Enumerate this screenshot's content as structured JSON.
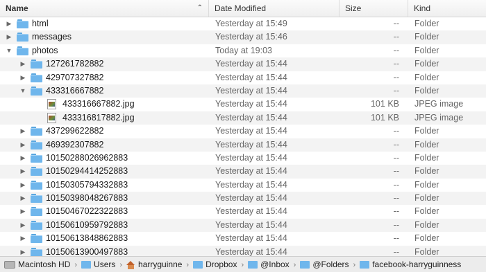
{
  "columns": {
    "name": "Name",
    "date": "Date Modified",
    "size": "Size",
    "kind": "Kind",
    "sort_indicator": "⌃"
  },
  "rows": [
    {
      "name": "html",
      "date": "Yesterday at 15:49",
      "size": "--",
      "kind": "Folder",
      "indent": 0,
      "disclosure": "right",
      "icon": "folder-icon"
    },
    {
      "name": "messages",
      "date": "Yesterday at 15:46",
      "size": "--",
      "kind": "Folder",
      "indent": 0,
      "disclosure": "right",
      "icon": "folder-icon"
    },
    {
      "name": "photos",
      "date": "Today at 19:03",
      "size": "--",
      "kind": "Folder",
      "indent": 0,
      "disclosure": "down",
      "icon": "folder-icon"
    },
    {
      "name": "127261782882",
      "date": "Yesterday at 15:44",
      "size": "--",
      "kind": "Folder",
      "indent": 1,
      "disclosure": "right",
      "icon": "folder-icon"
    },
    {
      "name": "429707327882",
      "date": "Yesterday at 15:44",
      "size": "--",
      "kind": "Folder",
      "indent": 1,
      "disclosure": "right",
      "icon": "folder-icon"
    },
    {
      "name": "433316667882",
      "date": "Yesterday at 15:44",
      "size": "--",
      "kind": "Folder",
      "indent": 1,
      "disclosure": "down",
      "icon": "folder-icon"
    },
    {
      "name": "433316667882.jpg",
      "date": "Yesterday at 15:44",
      "size": "101 KB",
      "kind": "JPEG image",
      "indent": 2,
      "disclosure": "none",
      "icon": "image-icon"
    },
    {
      "name": "433316817882.jpg",
      "date": "Yesterday at 15:44",
      "size": "101 KB",
      "kind": "JPEG image",
      "indent": 2,
      "disclosure": "none",
      "icon": "image-icon"
    },
    {
      "name": "437299622882",
      "date": "Yesterday at 15:44",
      "size": "--",
      "kind": "Folder",
      "indent": 1,
      "disclosure": "right",
      "icon": "folder-icon"
    },
    {
      "name": "469392307882",
      "date": "Yesterday at 15:44",
      "size": "--",
      "kind": "Folder",
      "indent": 1,
      "disclosure": "right",
      "icon": "folder-icon"
    },
    {
      "name": "10150288026962883",
      "date": "Yesterday at 15:44",
      "size": "--",
      "kind": "Folder",
      "indent": 1,
      "disclosure": "right",
      "icon": "folder-icon"
    },
    {
      "name": "10150294414252883",
      "date": "Yesterday at 15:44",
      "size": "--",
      "kind": "Folder",
      "indent": 1,
      "disclosure": "right",
      "icon": "folder-icon"
    },
    {
      "name": "10150305794332883",
      "date": "Yesterday at 15:44",
      "size": "--",
      "kind": "Folder",
      "indent": 1,
      "disclosure": "right",
      "icon": "folder-icon"
    },
    {
      "name": "10150398048267883",
      "date": "Yesterday at 15:44",
      "size": "--",
      "kind": "Folder",
      "indent": 1,
      "disclosure": "right",
      "icon": "folder-icon"
    },
    {
      "name": "10150467022322883",
      "date": "Yesterday at 15:44",
      "size": "--",
      "kind": "Folder",
      "indent": 1,
      "disclosure": "right",
      "icon": "folder-icon"
    },
    {
      "name": "10150610959792883",
      "date": "Yesterday at 15:44",
      "size": "--",
      "kind": "Folder",
      "indent": 1,
      "disclosure": "right",
      "icon": "folder-icon"
    },
    {
      "name": "10150613848862883",
      "date": "Yesterday at 15:44",
      "size": "--",
      "kind": "Folder",
      "indent": 1,
      "disclosure": "right",
      "icon": "folder-icon"
    },
    {
      "name": "10150613900497883",
      "date": "Yesterday at 15:44",
      "size": "--",
      "kind": "Folder",
      "indent": 1,
      "disclosure": "right",
      "icon": "folder-icon"
    }
  ],
  "pathbar": [
    {
      "label": "Macintosh HD",
      "icon": "hard-drive-icon"
    },
    {
      "label": "Users",
      "icon": "folder-icon"
    },
    {
      "label": "harryguinne",
      "icon": "home-icon"
    },
    {
      "label": "Dropbox",
      "icon": "folder-icon"
    },
    {
      "label": "@Inbox",
      "icon": "folder-icon"
    },
    {
      "label": "@Folders",
      "icon": "folder-icon"
    },
    {
      "label": "facebook-harryguinness",
      "icon": "folder-icon"
    }
  ],
  "pathbar_separator": "›",
  "colors": {
    "folder": "#6fb6ec",
    "alt_row": "#f3f3f3"
  }
}
